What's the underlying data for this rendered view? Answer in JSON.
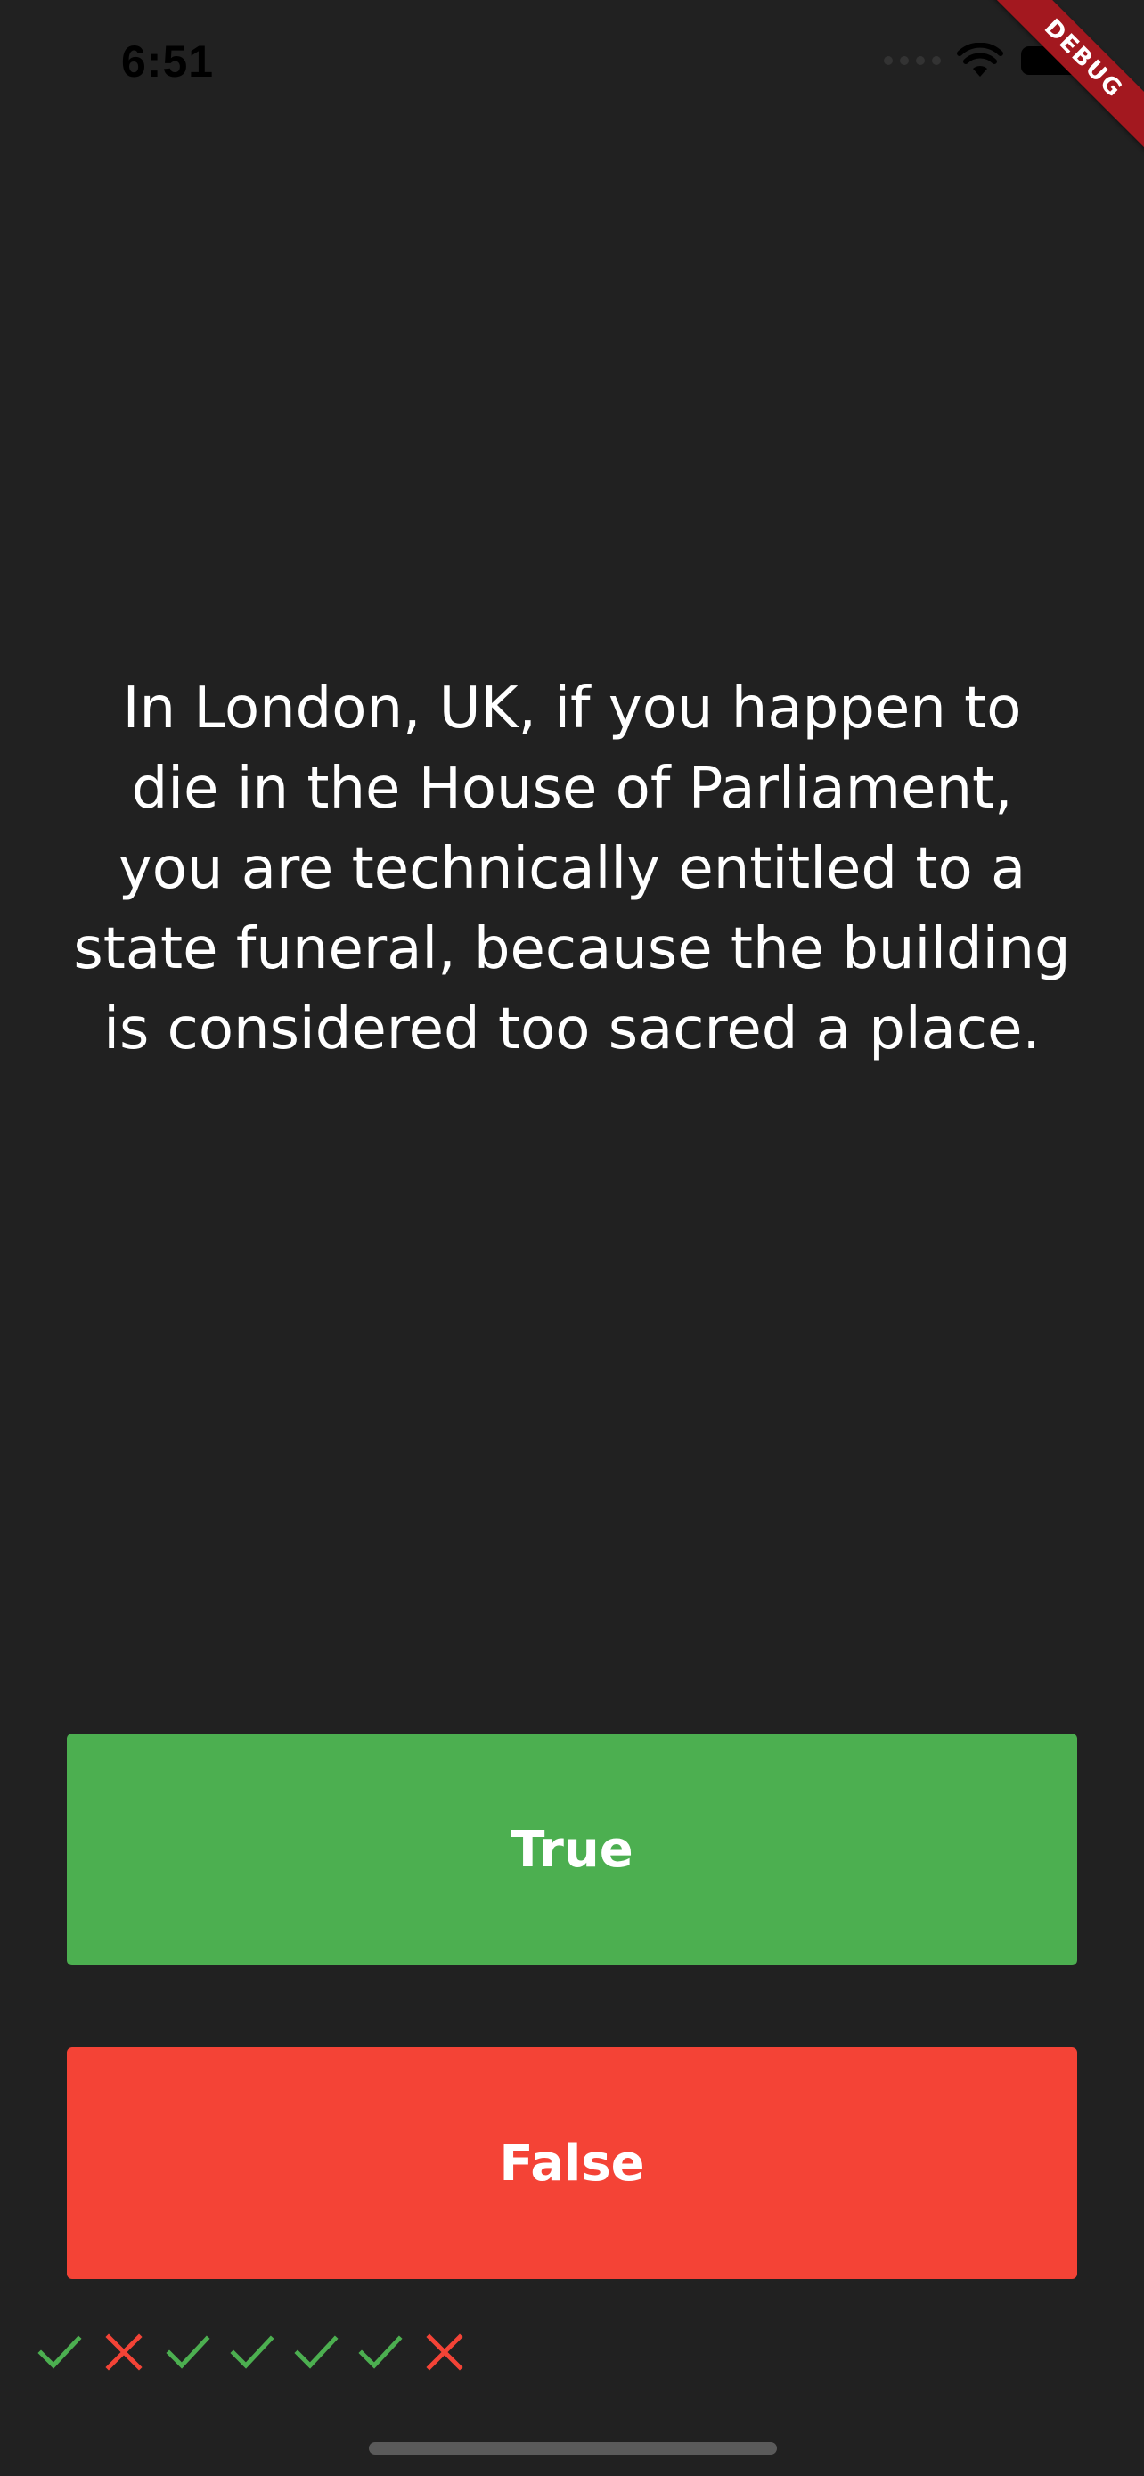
{
  "status_bar": {
    "time": "6:51"
  },
  "debug_banner": {
    "label": "DEBUG"
  },
  "question": {
    "text": "In London, UK, if you happen to die in the House of Parliament, you are technically entitled to a state funeral, because the building is considered too sacred a place."
  },
  "buttons": {
    "true_label": "True",
    "false_label": "False"
  },
  "score": [
    "check-icon",
    "cross-icon",
    "check-icon",
    "check-icon",
    "check-icon",
    "check-icon",
    "cross-icon"
  ],
  "colors": {
    "background": "#212121",
    "true_button": "#4caf50",
    "false_button": "#f44336",
    "check": "#4caf50",
    "cross": "#f44336",
    "debug_ribbon": "#a3181f"
  }
}
